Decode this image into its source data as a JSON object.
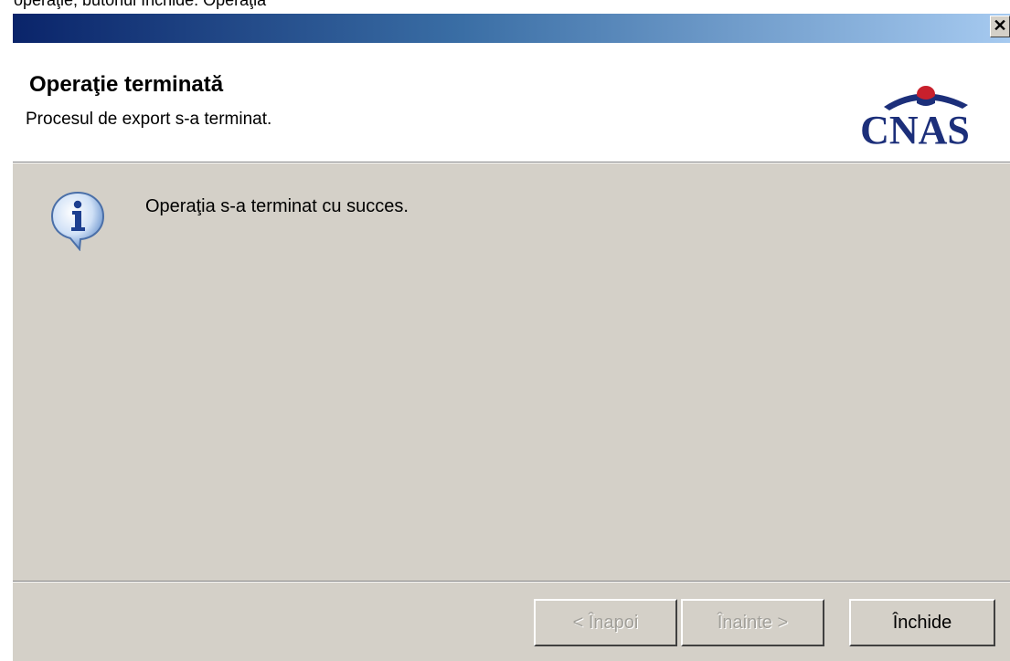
{
  "top_strip": {
    "text": "operaţie, butonul Închide. Operaţia"
  },
  "window": {
    "close_glyph": "✕"
  },
  "header": {
    "title": "Operaţie terminată",
    "subtitle": "Procesul de export s-a terminat.",
    "logo_text": "CNAS"
  },
  "body": {
    "icon": "info-icon",
    "message": "Operaţia s-a terminat cu succes."
  },
  "buttons": {
    "back": "< Înapoi",
    "next": "Înainte >",
    "close": "Închide"
  },
  "colors": {
    "titlebar_start": "#0a246a",
    "titlebar_end": "#a6caf0",
    "dialog_bg": "#d4d0c8",
    "logo_blue": "#1c2f7a",
    "logo_red": "#c8202c"
  }
}
